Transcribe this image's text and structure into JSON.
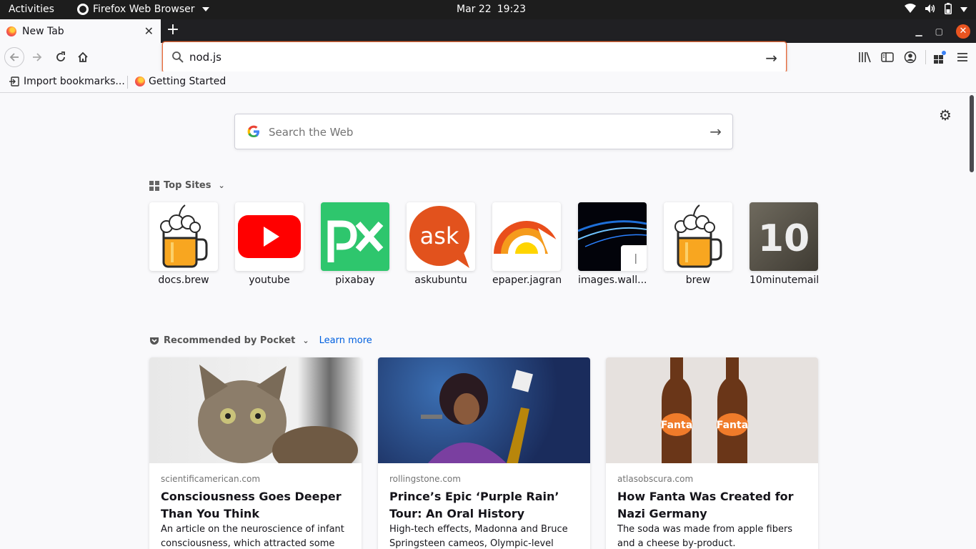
{
  "system_bar": {
    "activities": "Activities",
    "app_name": "Firefox Web Browser",
    "date": "Mar 22",
    "time": "19:23"
  },
  "tabs": [
    {
      "title": "New Tab",
      "active": true
    }
  ],
  "url_bar": {
    "value": "nod.js"
  },
  "bookmarks": [
    {
      "label": "Import bookmarks..."
    },
    {
      "label": "Getting Started"
    }
  ],
  "newtab": {
    "search_placeholder": "Search the Web",
    "top_sites_heading": "Top Sites",
    "top_sites": [
      {
        "label": "docs.brew"
      },
      {
        "label": "youtube"
      },
      {
        "label": "pixabay"
      },
      {
        "label": "askubuntu"
      },
      {
        "label": "epaper.jagran"
      },
      {
        "label": "images.wall..."
      },
      {
        "label": "brew"
      },
      {
        "label": "10minutemail"
      }
    ],
    "pocket_heading": "Recommended by Pocket",
    "learn_more": "Learn more",
    "stories": [
      {
        "source": "scientificamerican.com",
        "title": "Consciousness Goes Deeper Than You Think",
        "description": "An article on the neuroscience of infant consciousness, which attracted some"
      },
      {
        "source": "rollingstone.com",
        "title": "Prince’s Epic ‘Purple Rain’ Tour: An Oral History",
        "description": "High-tech effects, Madonna and Bruce Springsteen cameos, Olympic-level"
      },
      {
        "source": "atlasobscura.com",
        "title": "How Fanta Was Created for Nazi Germany",
        "description": "The soda was made from apple fibers and a cheese by-product."
      }
    ]
  },
  "colors": {
    "accent": "#e66b3b",
    "link": "#0060df",
    "ubuntu_orange": "#e95420"
  }
}
